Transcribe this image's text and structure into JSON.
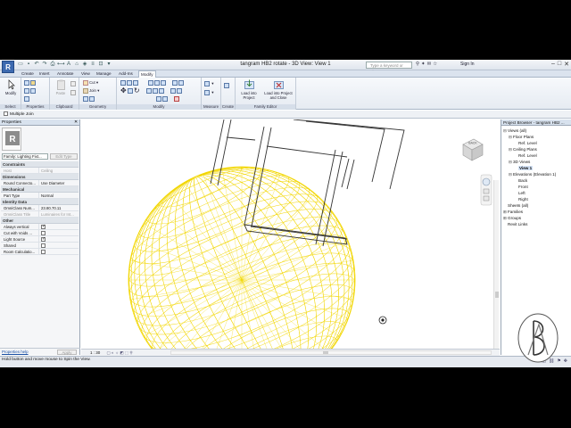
{
  "window": {
    "title": "tangram HB2 rotate - 3D View: View 1",
    "app_icon": "R",
    "search_placeholder": "Type a keyword or phrase",
    "sign_in": "Sign In"
  },
  "ribbon_tabs": [
    "Create",
    "Insert",
    "Annotate",
    "View",
    "Manage",
    "Add-Ins",
    "Modify"
  ],
  "active_tab": "Modify",
  "ribbon": {
    "modify_label": "Modify",
    "cut_label": "Cut",
    "join_label": "Join",
    "paste_label": "Paste",
    "load_project_label": "Load into Project",
    "load_close_label": "Load into Project and Close",
    "panels": [
      "Select",
      "Properties",
      "Clipboard",
      "Geometry",
      "Modify",
      "Measure",
      "Create",
      "Family Editor"
    ]
  },
  "option_bar": {
    "multiple_join": "Multiple Join"
  },
  "properties": {
    "header": "Properties",
    "type_selector": "Family: Lighting Fixt...",
    "edit_type": "Edit Type",
    "help_link": "Properties help",
    "apply_label": "Apply",
    "groups": [
      {
        "name": "Constraints",
        "rows": [
          {
            "key": "Host",
            "value": "Ceiling",
            "grey": true
          }
        ]
      },
      {
        "name": "Dimensions",
        "rows": [
          {
            "key": "Round Connecto...",
            "value": "Use Diameter"
          }
        ]
      },
      {
        "name": "Mechanical",
        "rows": [
          {
            "key": "Part Type",
            "value": "Normal"
          }
        ]
      },
      {
        "name": "Identity Data",
        "rows": [
          {
            "key": "OmniClass Num...",
            "value": "23.80.70.11"
          },
          {
            "key": "OmniClass Title",
            "value": "Luminaires for Int...",
            "grey": true
          }
        ]
      },
      {
        "name": "Other",
        "rows": [
          {
            "key": "Always vertical",
            "check": true
          },
          {
            "key": "Cut with Voids ...",
            "check": false
          },
          {
            "key": "Light Source",
            "check": true
          },
          {
            "key": "Shared",
            "check": false
          },
          {
            "key": "Room Calculatio...",
            "check": false
          }
        ]
      }
    ]
  },
  "viewport": {
    "scale": "1 : 30",
    "viewcube_label": "BACK"
  },
  "browser": {
    "header": "Project Browser - tangram HB2 ...",
    "tree": [
      {
        "level": 0,
        "toggle": "−",
        "label": "Views (all)"
      },
      {
        "level": 1,
        "toggle": "−",
        "label": "Floor Plans"
      },
      {
        "level": 2,
        "toggle": "",
        "label": "Ref. Level"
      },
      {
        "level": 1,
        "toggle": "−",
        "label": "Ceiling Plans"
      },
      {
        "level": 2,
        "toggle": "",
        "label": "Ref. Level"
      },
      {
        "level": 1,
        "toggle": "−",
        "label": "3D Views"
      },
      {
        "level": 2,
        "toggle": "",
        "label": "View 1",
        "selected": true
      },
      {
        "level": 1,
        "toggle": "−",
        "label": "Elevations (Elevation 1)"
      },
      {
        "level": 2,
        "toggle": "",
        "label": "Back"
      },
      {
        "level": 2,
        "toggle": "",
        "label": "Front"
      },
      {
        "level": 2,
        "toggle": "",
        "label": "Left"
      },
      {
        "level": 2,
        "toggle": "",
        "label": "Right"
      },
      {
        "level": 0,
        "toggle": "",
        "label": "Sheets (all)"
      },
      {
        "level": 0,
        "toggle": "+",
        "label": "Families"
      },
      {
        "level": 0,
        "toggle": "+",
        "label": "Groups"
      },
      {
        "level": 0,
        "toggle": "",
        "label": "Revit Links"
      }
    ]
  },
  "status_bar": {
    "text": "Hold button and move mouse to Spin the View."
  },
  "colors": {
    "wireframe": "#f2d600",
    "accent": "#3d6ab0"
  }
}
